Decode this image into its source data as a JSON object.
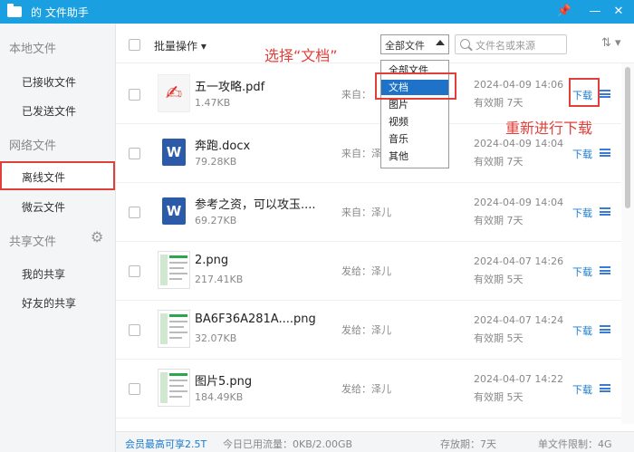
{
  "titlebar": {
    "title": "的 文件助手",
    "pin": "📌",
    "minimize": "—",
    "close": "✕"
  },
  "sidebar": {
    "local_header": "本地文件",
    "received": "已接收文件",
    "sent": "已发送文件",
    "network_header": "网络文件",
    "offline": "离线文件",
    "weiyun": "微云文件",
    "share_header": "共享文件",
    "my_share": "我的共享",
    "friend_share": "好友的共享"
  },
  "toolbar": {
    "batch_label": "批量操作 ▾",
    "filter_value": "全部文件",
    "search_placeholder": "文件名或来源",
    "sort_icon": "⇅ ▾"
  },
  "annotations": {
    "select_doc": "选择“文档”",
    "redownload": "重新进行下载"
  },
  "dropdown": {
    "options": [
      "全部文件",
      "文档",
      "图片",
      "视频",
      "音乐",
      "其他"
    ],
    "selected": "文档"
  },
  "files": [
    {
      "name": "五一攻略.pdf",
      "size": "1.47KB",
      "from": "来自：",
      "date": "2024-04-09 14:06",
      "valid": "有效期 7天",
      "action": "下载",
      "thumb": "pdf"
    },
    {
      "name": "奔跑.docx",
      "size": "79.28KB",
      "from": "来自：泽",
      "date": "2024-04-09 14:04",
      "valid": "有效期 7天",
      "action": "下载",
      "thumb": "doc"
    },
    {
      "name": "参考之资，可以攻玉....",
      "size": "69.27KB",
      "from": "来自：泽儿",
      "date": "2024-04-09 14:04",
      "valid": "有效期 7天",
      "action": "下载",
      "thumb": "doc"
    },
    {
      "name": "2.png",
      "size": "217.41KB",
      "from": "发给：泽儿",
      "date": "2024-04-07 14:26",
      "valid": "有效期 5天",
      "action": "下载",
      "thumb": "img"
    },
    {
      "name": "BA6F36A281A....png",
      "size": "32.07KB",
      "from": "发给：泽儿",
      "date": "2024-04-07 14:24",
      "valid": "有效期 5天",
      "action": "下载",
      "thumb": "img"
    },
    {
      "name": "图片5.png",
      "size": "184.49KB",
      "from": "发给：泽儿",
      "date": "2024-04-07 14:22",
      "valid": "有效期 5天",
      "action": "下载",
      "thumb": "img"
    }
  ],
  "footer": {
    "vip": "会员最高可享2.5T",
    "traffic": "今日已用流量：0KB/2.00GB",
    "storage": "存放期：7天",
    "limit": "单文件限制：4G"
  },
  "colors": {
    "accent": "#1aa0e0",
    "annotation": "#e0403a",
    "link": "#1a7cd0"
  }
}
